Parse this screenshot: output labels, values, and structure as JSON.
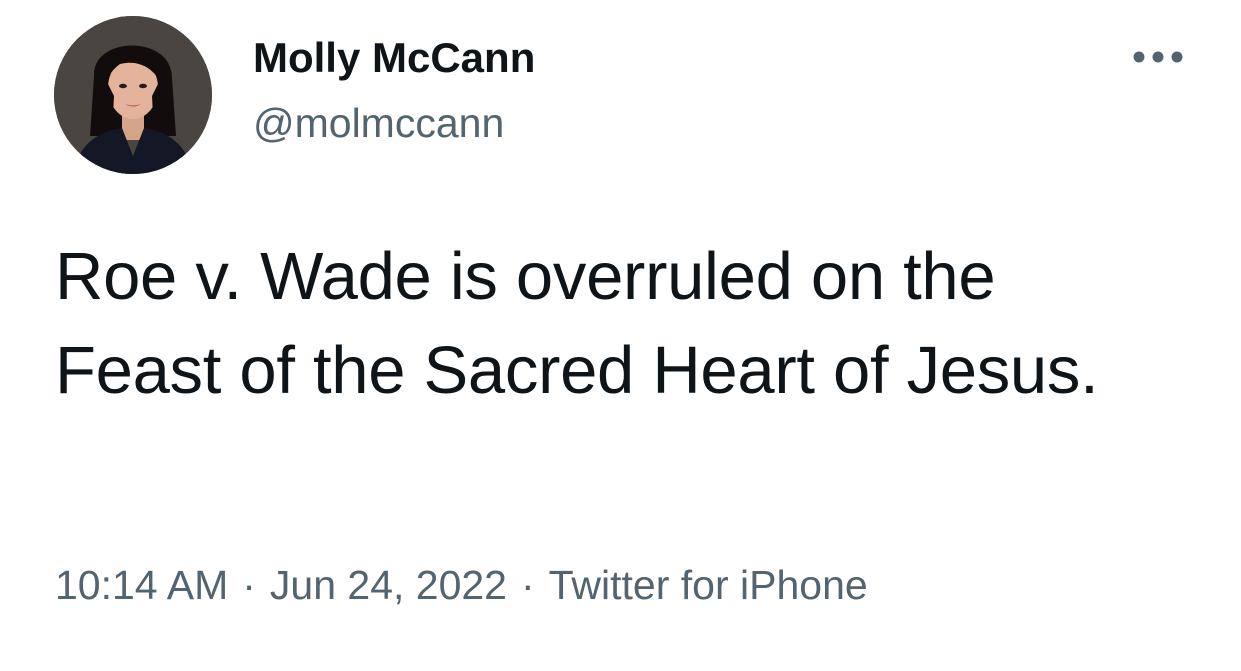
{
  "author": {
    "display_name": "Molly McCann",
    "handle": "@molmccann",
    "avatar_icon": "profile-photo"
  },
  "more_icon": "more-horizontal-icon",
  "tweet": {
    "text": "Roe v. Wade is overruled on the Feast of the Sacred Heart of Jesus."
  },
  "meta": {
    "time": "10:14 AM",
    "separator": "·",
    "date": "Jun 24, 2022",
    "source": "Twitter for iPhone"
  },
  "colors": {
    "primary_text": "#0f1419",
    "secondary_text": "#536471",
    "background": "#ffffff"
  }
}
